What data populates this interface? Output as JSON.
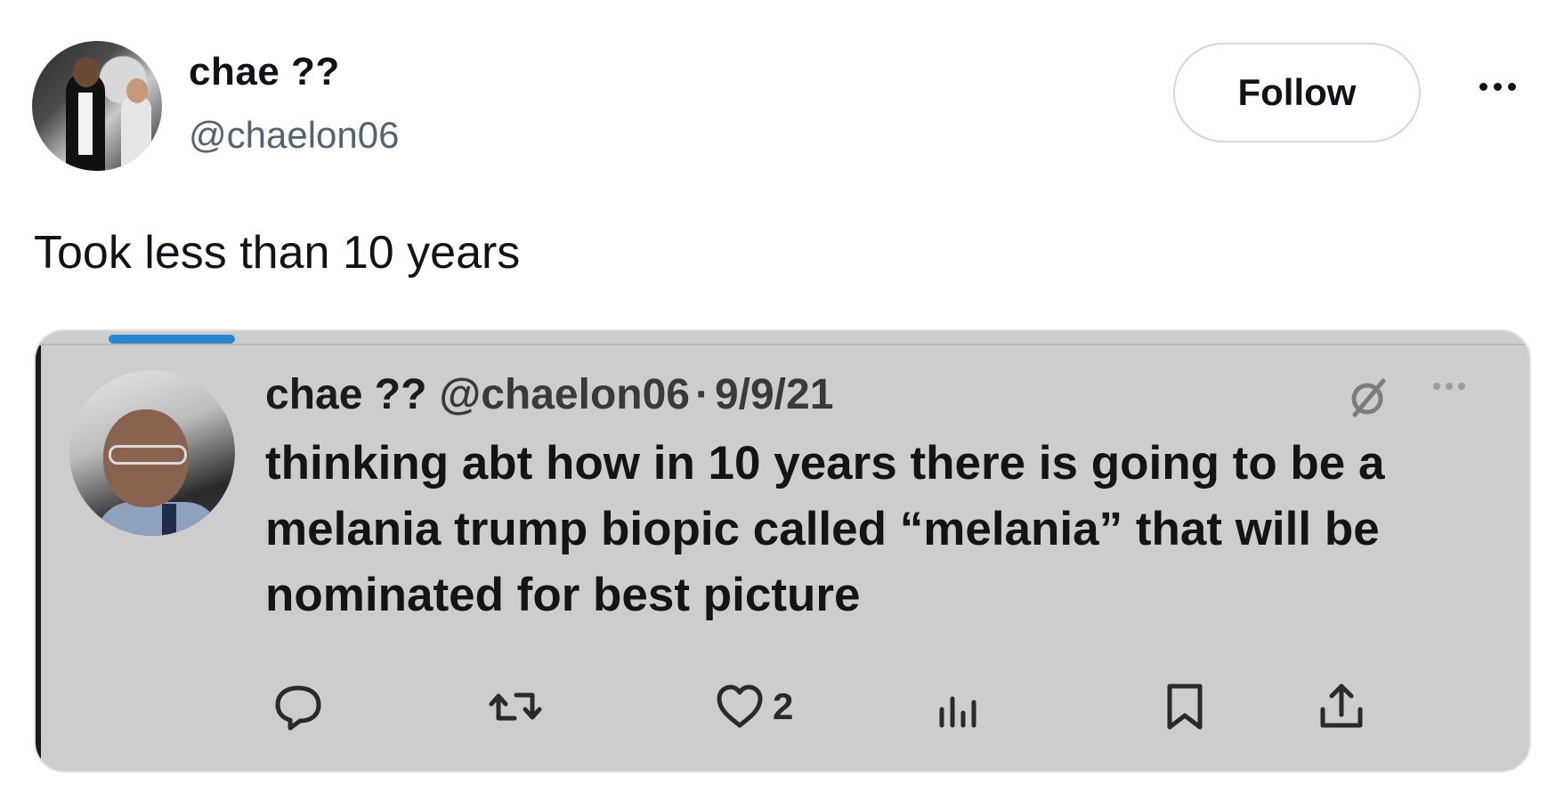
{
  "post": {
    "author_name": "chae ??",
    "author_handle": "@chaelon06",
    "follow_label": "Follow",
    "text": "Took less than 10 years"
  },
  "quoted": {
    "author_name": "chae ??",
    "author_handle": "@chaelon06",
    "separator": "·",
    "date": "9/9/21",
    "text": "thinking abt how in 10 years there is going to be a melania trump biopic called “melania” that will be nominated for best picture",
    "actions": {
      "reply": {
        "icon": "reply-icon"
      },
      "repost": {
        "icon": "repost-icon"
      },
      "like": {
        "icon": "heart-icon",
        "count": "2"
      },
      "views": {
        "icon": "views-icon"
      },
      "bookmark": {
        "icon": "bookmark-icon"
      },
      "share": {
        "icon": "share-icon"
      }
    }
  },
  "colors": {
    "secondary_text": "#536471",
    "card_background": "#cdcdcd",
    "tab_accent": "#2b86d3"
  }
}
